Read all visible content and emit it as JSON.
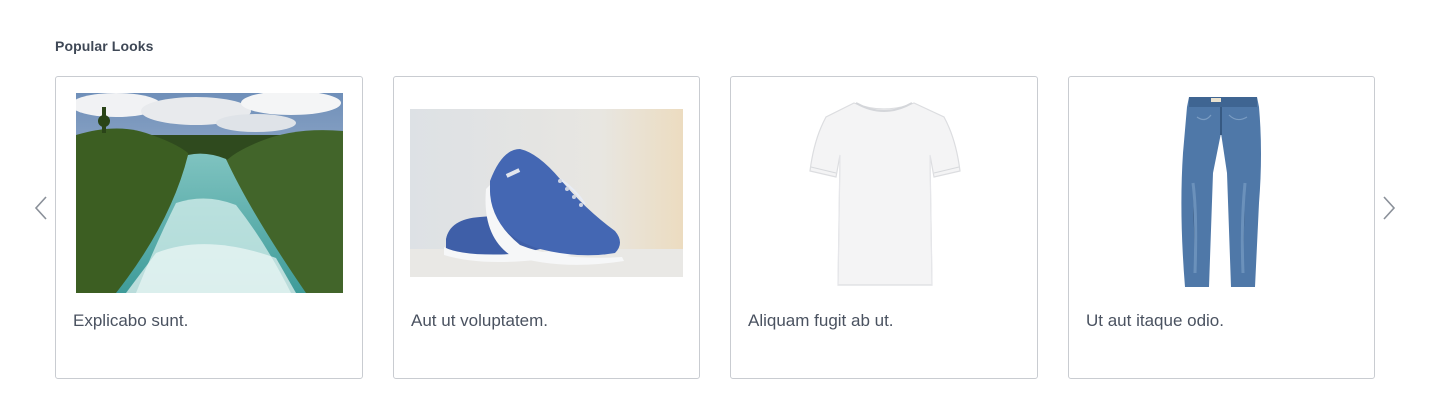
{
  "section": {
    "title": "Popular Looks"
  },
  "carousel": {
    "prev_icon": "chevron-left-icon",
    "next_icon": "chevron-right-icon",
    "items": [
      {
        "caption": "Explicabo sunt.",
        "image": "river-rapids-photo"
      },
      {
        "caption": "Aut ut voluptatem.",
        "image": "blue-sneakers-photo"
      },
      {
        "caption": "Aliquam fugit ab ut.",
        "image": "white-tshirt-photo"
      },
      {
        "caption": "Ut aut itaque odio.",
        "image": "blue-jeans-photo"
      }
    ]
  },
  "colors": {
    "title": "#3f4856",
    "caption": "#4a5260",
    "card_border": "#c9ccd1",
    "arrow": "#8a9099"
  }
}
